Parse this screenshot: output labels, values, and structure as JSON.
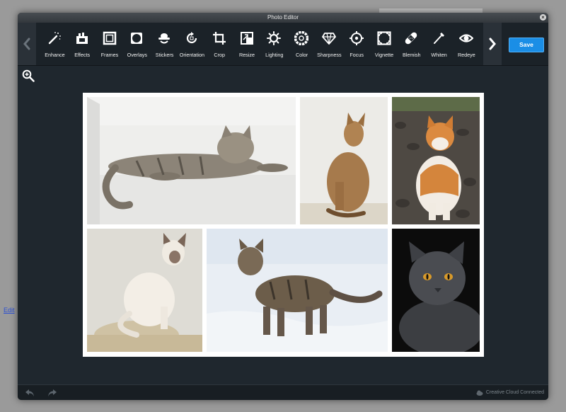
{
  "background": {
    "link_label": "Edit"
  },
  "window": {
    "title": "Photo Editor",
    "close_glyph": "×"
  },
  "toolbar": {
    "tools": [
      {
        "label": "Enhance",
        "icon": "magic-wand-icon"
      },
      {
        "label": "Effects",
        "icon": "effects-icon"
      },
      {
        "label": "Frames",
        "icon": "frame-icon"
      },
      {
        "label": "Overlays",
        "icon": "overlay-icon"
      },
      {
        "label": "Stickers",
        "icon": "sticker-icon"
      },
      {
        "label": "Orientation",
        "icon": "rotate-icon"
      },
      {
        "label": "Crop",
        "icon": "crop-icon"
      },
      {
        "label": "Resize",
        "icon": "resize-icon"
      },
      {
        "label": "Lighting",
        "icon": "sun-icon"
      },
      {
        "label": "Color",
        "icon": "color-wheel-icon"
      },
      {
        "label": "Sharpness",
        "icon": "diamond-icon"
      },
      {
        "label": "Focus",
        "icon": "target-icon"
      },
      {
        "label": "Vignette",
        "icon": "vignette-icon"
      },
      {
        "label": "Blemish",
        "icon": "bandage-icon"
      },
      {
        "label": "Whiten",
        "icon": "whiten-brush-icon"
      },
      {
        "label": "Redeye",
        "icon": "eye-icon"
      }
    ],
    "save_label": "Save"
  },
  "footer": {
    "status": "Creative Cloud Connected"
  },
  "colors": {
    "accent": "#1a8ee6",
    "window_bg": "#1f272e",
    "toolbar_bg": "#1b2228"
  }
}
